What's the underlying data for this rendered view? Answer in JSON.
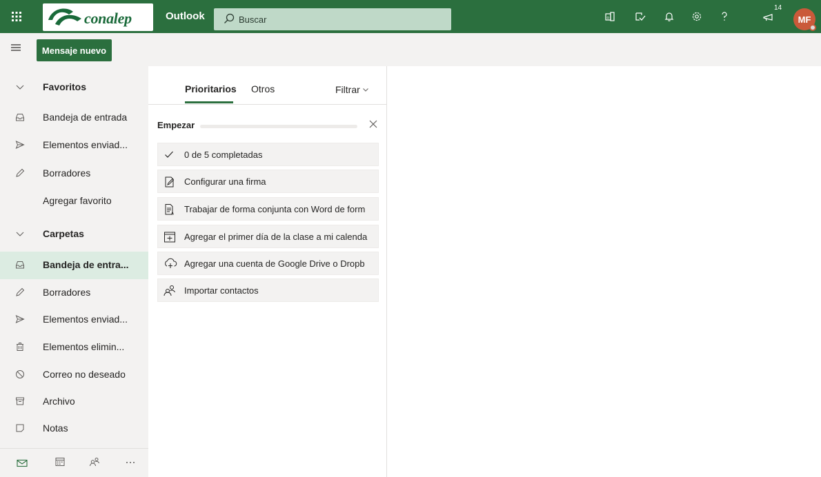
{
  "header": {
    "brand_name": "conalep",
    "app_name": "Outlook",
    "search_placeholder": "Buscar",
    "notification_badge": "14",
    "avatar_initials": "MF",
    "icons": [
      "waffle-icon",
      "office-icon",
      "to-do-icon",
      "bell-icon",
      "settings-gear-icon",
      "help-icon",
      "megaphone-icon"
    ],
    "brand_color": "#2b6f3e"
  },
  "command_bar": {
    "new_message_label": "Mensaje nuevo"
  },
  "sidebar": {
    "favorites_header": "Favoritos",
    "favorites": [
      {
        "label": "Bandeja de entrada",
        "icon": "inbox-icon"
      },
      {
        "label": "Elementos enviad...",
        "icon": "send-icon"
      },
      {
        "label": "Borradores",
        "icon": "pencil-icon"
      }
    ],
    "add_favorite": "Agregar favorito",
    "folders_header": "Carpetas",
    "folders": [
      {
        "label": "Bandeja de entra...",
        "icon": "inbox-icon",
        "selected": true
      },
      {
        "label": "Borradores",
        "icon": "pencil-icon"
      },
      {
        "label": "Elementos enviad...",
        "icon": "send-icon"
      },
      {
        "label": "Elementos elimin...",
        "icon": "trash-icon"
      },
      {
        "label": "Correo no deseado",
        "icon": "blocked-icon"
      },
      {
        "label": "Archivo",
        "icon": "archive-icon"
      },
      {
        "label": "Notas",
        "icon": "note-icon"
      }
    ],
    "bottom_icons": [
      "mail-icon",
      "calendar-icon",
      "people-icon",
      "more-icon"
    ]
  },
  "message_list": {
    "tabs": [
      "Prioritarios",
      "Otros"
    ],
    "filter_label": "Filtrar",
    "get_started": {
      "title": "Empezar",
      "progress": 0,
      "tasks": [
        {
          "label": "0 de 5 completadas",
          "icon": "checkmark-icon"
        },
        {
          "label": "Configurar una firma",
          "icon": "signature-icon"
        },
        {
          "label": "Trabajar de forma conjunta con Word de form",
          "icon": "word-document-icon"
        },
        {
          "label": "Agregar el primer día de la clase a mi calenda",
          "icon": "calendar-add-icon"
        },
        {
          "label": "Agregar una cuenta de Google Drive o Dropb",
          "icon": "cloud-add-icon"
        },
        {
          "label": "Importar contactos",
          "icon": "people-icon"
        }
      ]
    }
  }
}
